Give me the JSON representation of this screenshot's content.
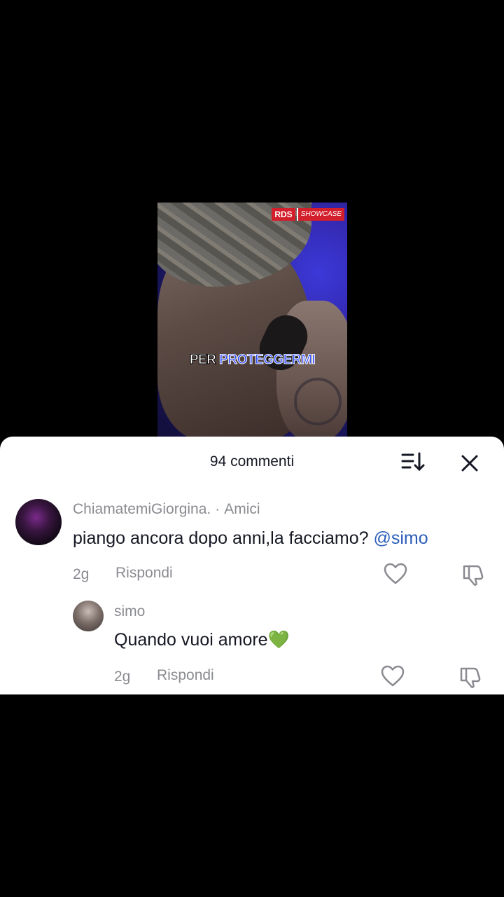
{
  "video": {
    "logo_brand": "RDS",
    "logo_sub": "SHOWCASE",
    "caption_word1": "PER",
    "caption_word2": "PROTEGGERMI"
  },
  "comments_sheet": {
    "title": "94 commenti",
    "sort_icon": "sort-icon",
    "close_icon": "close-icon",
    "comments": [
      {
        "username": "ChiamatemiGiorgina.",
        "relation": "Amici",
        "text": "piango ancora dopo anni,la facciamo?",
        "mention": "@simo",
        "time": "2g",
        "reply_label": "Rispondi"
      }
    ],
    "replies": [
      {
        "username": "simo",
        "text": "Quando vuoi amore💚",
        "time": "2g",
        "reply_label": "Rispondi"
      }
    ]
  },
  "colors": {
    "mention": "#2b5db8",
    "caption_highlight": "#2f4bff",
    "secondary_text": "#8a8b91"
  }
}
